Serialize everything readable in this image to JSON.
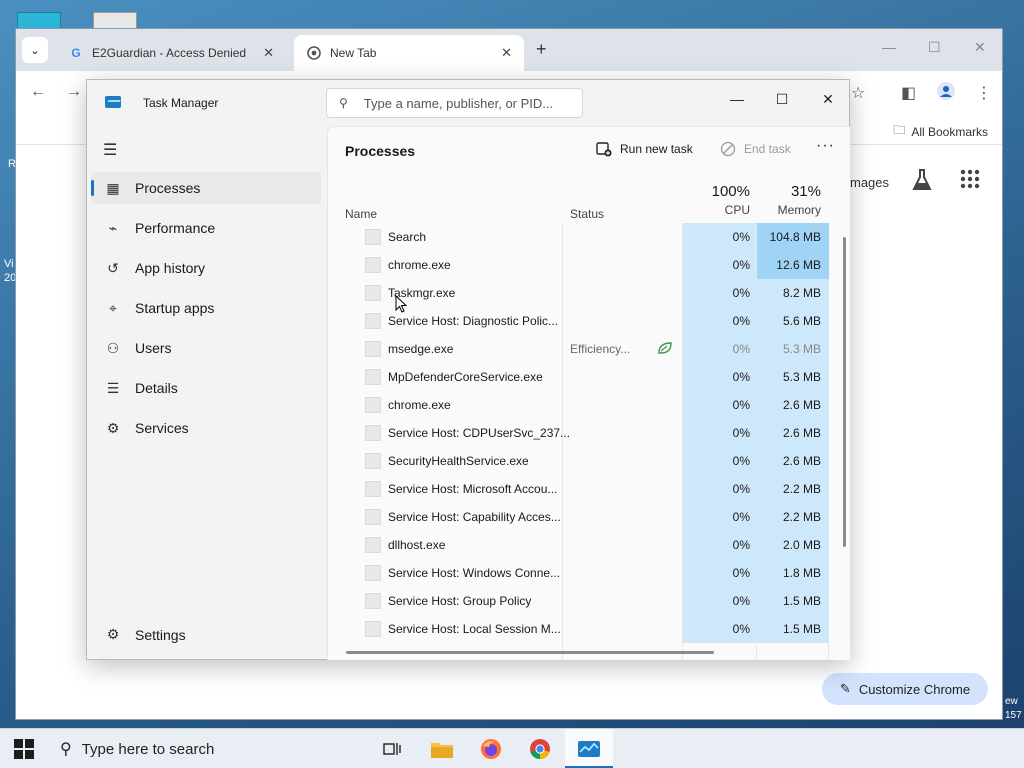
{
  "desktop": {
    "side_text": [
      "R",
      "Vi",
      "20"
    ],
    "right_text": [
      "ew",
      "157"
    ]
  },
  "chrome": {
    "tabs": [
      {
        "title": "E2Guardian - Access Denied",
        "icon": "google-g-icon",
        "close": "✕"
      },
      {
        "title": "New Tab",
        "icon": "chrome-icon",
        "close": "✕"
      }
    ],
    "new_tab": "+",
    "all_bookmarks": "All Bookmarks",
    "ntp_images": "mages",
    "customize_label": "Customize Chrome"
  },
  "task_manager": {
    "title": "Task Manager",
    "search_placeholder": "Type a name, publisher, or PID...",
    "nav": [
      {
        "label": "Processes",
        "icon": "processes-icon",
        "active": true
      },
      {
        "label": "Performance",
        "icon": "performance-icon"
      },
      {
        "label": "App history",
        "icon": "app-history-icon"
      },
      {
        "label": "Startup apps",
        "icon": "startup-apps-icon"
      },
      {
        "label": "Users",
        "icon": "users-icon"
      },
      {
        "label": "Details",
        "icon": "details-icon"
      },
      {
        "label": "Services",
        "icon": "services-icon"
      }
    ],
    "settings_label": "Settings",
    "page_title": "Processes",
    "run_new_task": "Run new task",
    "end_task": "End task",
    "columns": {
      "name": "Name",
      "status": "Status",
      "cpu_pct": "100%",
      "cpu": "CPU",
      "mem_pct": "31%",
      "memory": "Memory"
    },
    "processes": [
      {
        "name": "Search",
        "status": "",
        "cpu": "0%",
        "memory": "104.8 MB",
        "mem_highlight": true
      },
      {
        "name": "chrome.exe",
        "status": "",
        "cpu": "0%",
        "memory": "12.6 MB",
        "mem_highlight": true
      },
      {
        "name": "Taskmgr.exe",
        "status": "",
        "cpu": "0%",
        "memory": "8.2 MB"
      },
      {
        "name": "Service Host: Diagnostic Polic...",
        "status": "",
        "cpu": "0%",
        "memory": "5.6 MB"
      },
      {
        "name": "msedge.exe",
        "status": "Efficiency...",
        "cpu": "0%",
        "memory": "5.3 MB",
        "efficiency": true
      },
      {
        "name": "MpDefenderCoreService.exe",
        "status": "",
        "cpu": "0%",
        "memory": "5.3 MB"
      },
      {
        "name": "chrome.exe",
        "status": "",
        "cpu": "0%",
        "memory": "2.6 MB"
      },
      {
        "name": "Service Host: CDPUserSvc_237...",
        "status": "",
        "cpu": "0%",
        "memory": "2.6 MB"
      },
      {
        "name": "SecurityHealthService.exe",
        "status": "",
        "cpu": "0%",
        "memory": "2.6 MB"
      },
      {
        "name": "Service Host: Microsoft Accou...",
        "status": "",
        "cpu": "0%",
        "memory": "2.2 MB"
      },
      {
        "name": "Service Host: Capability Acces...",
        "status": "",
        "cpu": "0%",
        "memory": "2.2 MB"
      },
      {
        "name": "dllhost.exe",
        "status": "",
        "cpu": "0%",
        "memory": "2.0 MB"
      },
      {
        "name": "Service Host: Windows Conne...",
        "status": "",
        "cpu": "0%",
        "memory": "1.8 MB"
      },
      {
        "name": "Service Host: Group Policy",
        "status": "",
        "cpu": "0%",
        "memory": "1.5 MB"
      },
      {
        "name": "Service Host: Local Session M...",
        "status": "",
        "cpu": "0%",
        "memory": "1.5 MB"
      }
    ]
  },
  "taskbar": {
    "search_placeholder": "Type here to search",
    "apps": [
      "task-view-icon",
      "file-explorer-icon",
      "firefox-icon",
      "chrome-icon",
      "task-manager-icon"
    ]
  }
}
